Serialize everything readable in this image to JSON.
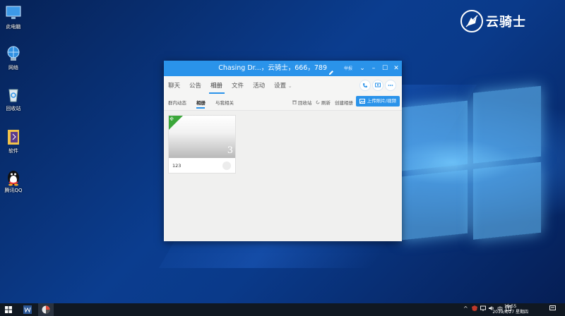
{
  "desktop": {
    "icons": [
      {
        "label": "此电脑",
        "icon": "computer-icon"
      },
      {
        "label": "网络",
        "icon": "network-icon"
      },
      {
        "label": "回收站",
        "icon": "recycle-bin-icon"
      },
      {
        "label": "软件",
        "icon": "folder-icon"
      },
      {
        "label": "腾讯QQ",
        "icon": "qq-penguin-icon"
      }
    ],
    "brand_text": "云骑士"
  },
  "window": {
    "title": "Chasing Dr...，云骑士，666，789",
    "tag": "举报",
    "controls": {
      "menu": "⌄",
      "minimize": "–",
      "maximize": "☐",
      "close": "✕"
    },
    "tabs": [
      {
        "label": "聊天"
      },
      {
        "label": "公告"
      },
      {
        "label": "相册"
      },
      {
        "label": "文件"
      },
      {
        "label": "活动"
      },
      {
        "label": "设置"
      }
    ],
    "settings_arrow": "⌄",
    "subtabs": [
      {
        "label": "群内动态"
      },
      {
        "label": "相册"
      },
      {
        "label": "与我相关"
      }
    ],
    "actions": {
      "recycle": "回收站",
      "refresh": "刷新",
      "create_album": "创建相册",
      "upload": "上传照片/视频"
    },
    "albums": [
      {
        "name": "123",
        "count": "3",
        "corner_tag": "群"
      }
    ]
  },
  "taskbar": {
    "tray": {
      "expand": "^",
      "ime": "中"
    },
    "clock": {
      "time": "15:55",
      "date": "2019/6/27 星期四"
    }
  },
  "colors": {
    "accent": "#2a93ea",
    "album_tag": "#3ba73a",
    "taskbar": "#101822"
  }
}
